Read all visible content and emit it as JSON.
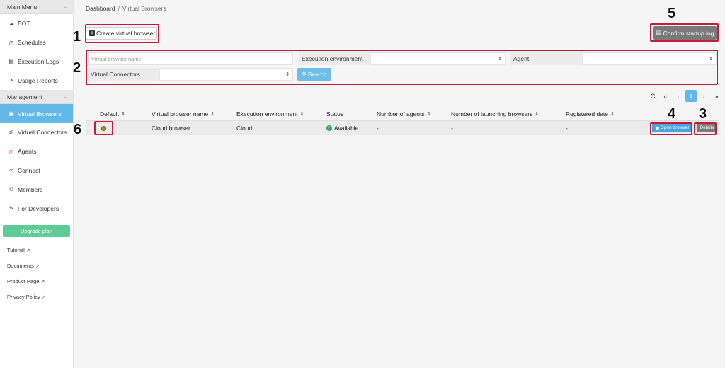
{
  "sidebar": {
    "main_menu_label": "Main Menu",
    "main_items": [
      {
        "label": "BOT",
        "icon": "cloud-icon"
      },
      {
        "label": "Schedules",
        "icon": "clock-icon"
      },
      {
        "label": "Execution Logs",
        "icon": "file-icon"
      },
      {
        "label": "Usage Reports",
        "icon": "pie-chart-icon"
      }
    ],
    "management_label": "Management",
    "management_items": [
      {
        "label": "Virtual Browsers",
        "icon": "browser-icon",
        "active": true
      },
      {
        "label": "Virtual Connectors",
        "icon": "connector-icon"
      },
      {
        "label": "Agents",
        "icon": "agent-icon"
      },
      {
        "label": "Connect",
        "icon": "link-icon"
      },
      {
        "label": "Members",
        "icon": "users-icon"
      },
      {
        "label": "For Developers",
        "icon": "wrench-icon"
      }
    ],
    "upgrade_label": "Upgrade plan",
    "links": [
      "Tutorial",
      "Documents",
      "Product Page",
      "Privacy Policy"
    ]
  },
  "breadcrumb": {
    "root": "Dashboard",
    "sep": "/",
    "current": "Virtual Browsers"
  },
  "toolbar": {
    "create_label": "Create virtual browser",
    "confirm_label": "Confirm startup log"
  },
  "filters": {
    "name_placeholder": "Virtual browser name",
    "execution_env_label": "Execution environment",
    "agent_label": "Agent",
    "connectors_label": "Virtual Connectors",
    "search_label": "Search",
    "select_arrow": "⇕"
  },
  "pagination": {
    "refresh": "C",
    "first": "«",
    "prev": "‹",
    "current": "1",
    "next": "›",
    "last": "»"
  },
  "table": {
    "headers": [
      "Default",
      "Virtual browser name",
      "Execution environment",
      "Status",
      "Number of agents",
      "Number of launching browsers",
      "Registered date"
    ],
    "rows": [
      {
        "name": "Cloud browser",
        "env": "Cloud",
        "status": "Available",
        "agents": "-",
        "launching": "-",
        "registered": "-",
        "open_label": "Open browser",
        "details_label": "Details"
      }
    ]
  },
  "annotations": [
    "1",
    "2",
    "3",
    "4",
    "5",
    "6"
  ],
  "colors": {
    "accent": "#62b8e8",
    "upgrade": "#5fcb96",
    "annotation_red": "#c41d3a",
    "gray_button": "#7a7a7a"
  }
}
